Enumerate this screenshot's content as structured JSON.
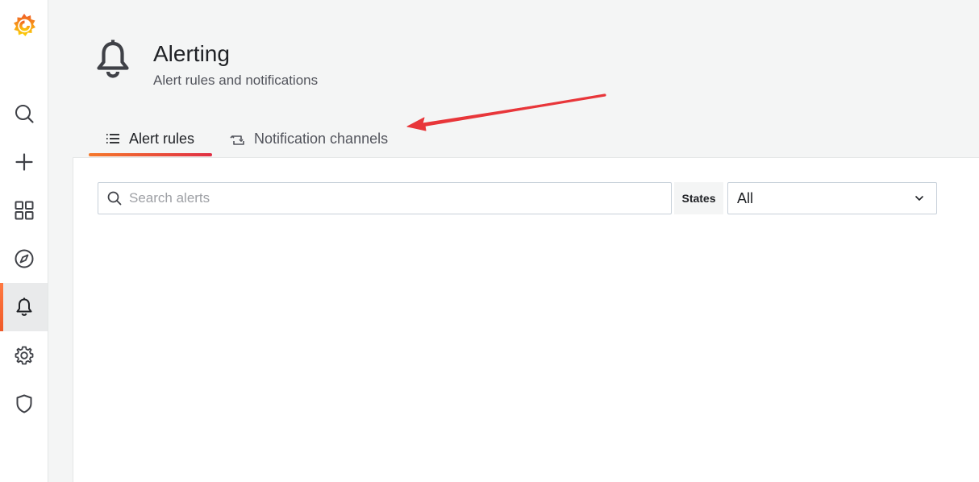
{
  "sidebar": {
    "logo_icon": "grafana-logo-icon",
    "items": [
      {
        "icon": "search-icon",
        "active": false
      },
      {
        "icon": "plus-icon",
        "active": false
      },
      {
        "icon": "dashboards-icon",
        "active": false
      },
      {
        "icon": "explore-compass-icon",
        "active": false
      },
      {
        "icon": "bell-icon",
        "active": true
      },
      {
        "icon": "gear-icon",
        "active": false
      },
      {
        "icon": "shield-icon",
        "active": false
      }
    ]
  },
  "header": {
    "icon": "bell-icon",
    "title": "Alerting",
    "subtitle": "Alert rules and notifications"
  },
  "tabs": [
    {
      "label": "Alert rules",
      "icon": "list-icon",
      "active": true
    },
    {
      "label": "Notification channels",
      "icon": "channels-icon",
      "active": false
    }
  ],
  "search": {
    "placeholder": "Search alerts",
    "value": ""
  },
  "states_filter": {
    "label": "States",
    "selected": "All"
  },
  "colors": {
    "accent_gradient_start": "#f5782a",
    "accent_gradient_end": "#e02f44",
    "annotation_arrow": "#e8363a"
  }
}
